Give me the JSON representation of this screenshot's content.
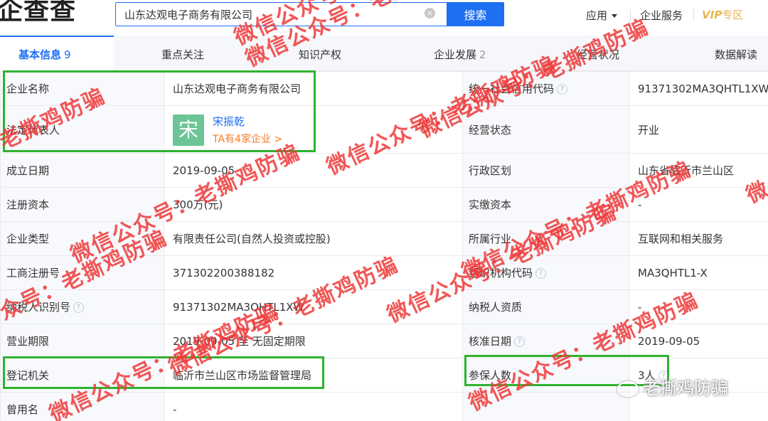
{
  "header": {
    "logo": "企查查",
    "search_value": "山东达观电子商务有限公司",
    "clear_symbol": "×",
    "search_button": "搜索",
    "nav_app": "应用",
    "nav_enterprise": "企业服务",
    "nav_vip": "VIP",
    "nav_vip_zone": "专区"
  },
  "tabs": [
    {
      "label": "基本信息",
      "count": "9"
    },
    {
      "label": "重点关注",
      "count": ""
    },
    {
      "label": "知识产权",
      "count": ""
    },
    {
      "label": "企业发展",
      "count": "2"
    },
    {
      "label": "经营状况",
      "count": ""
    },
    {
      "label": "数据解读",
      "count": ""
    }
  ],
  "info": {
    "name_label": "企业名称",
    "name_value": "山东达观电子商务有限公司",
    "credit_code_label": "统一社会信用代码",
    "credit_code_value": "91371302MA3QHTL1XW",
    "rep_label": "法定代表人",
    "rep_avatar": "宋",
    "rep_name": "宋振乾",
    "rep_companies": "TA有4家企业 >",
    "status_label": "经营状态",
    "status_value": "开业",
    "founded_label": "成立日期",
    "founded_value": "2019-09-05",
    "region_label": "行政区划",
    "region_value": "山东省临沂市兰山区",
    "reg_capital_label": "注册资本",
    "reg_capital_value": "300万(元)",
    "paid_capital_label": "实缴资本",
    "paid_capital_value": "-",
    "type_label": "企业类型",
    "type_value": "有限责任公司(自然人投资或控股)",
    "industry_label": "所属行业",
    "industry_value": "互联网和相关服务",
    "biz_reg_label": "工商注册号",
    "biz_reg_value": "371302200388182",
    "org_code_label": "组织机构代码",
    "org_code_value": "MA3QHTL1-X",
    "taxpayer_id_label": "纳税人识别号",
    "taxpayer_id_value": "91371302MA3QHTL1XW",
    "taxpayer_qual_label": "纳税人资质",
    "taxpayer_qual_value": "-",
    "term_label": "营业期限",
    "term_value": "2019-09-05 至 无固定期限",
    "approval_label": "核准日期",
    "approval_value": "2019-09-05",
    "authority_label": "登记机关",
    "authority_value": "临沂市兰山区市场监督管理局",
    "insured_label": "参保人数",
    "insured_value": "3人",
    "former_name_label": "曾用名",
    "former_name_value": "-"
  },
  "watermark_texts": {
    "wm1": "微信公众号：老撕",
    "wm2": "老撕鸡防骗",
    "wm3": "微信公众号：老撕鸡防骗",
    "wm4": "微信公众号：老撕鸡防骗",
    "wm5": "微信公众号：老撕鸡防骗",
    "wm6": "微信公众号：老撕鸡防骗",
    "wm7": "众号：老撕鸡防骗",
    "wm8": "微信公众号：老撕鸡防骗",
    "wm9": "微信公众号：老撕鸡防骗",
    "wm10": "微信公众号：老撕鸡防骗",
    "wm11": "微信公众号：老撕鸡防骗",
    "wm12": "微信公众号：老撕",
    "wm13": "微"
  },
  "wechat_badge": "老撕鸡防骗",
  "colors": {
    "accent": "#1e6ff2",
    "highlight_box": "#2fb32f",
    "watermark": "#ee3a3a",
    "link_orange": "#f77b24",
    "avatar": "#6cc596"
  }
}
